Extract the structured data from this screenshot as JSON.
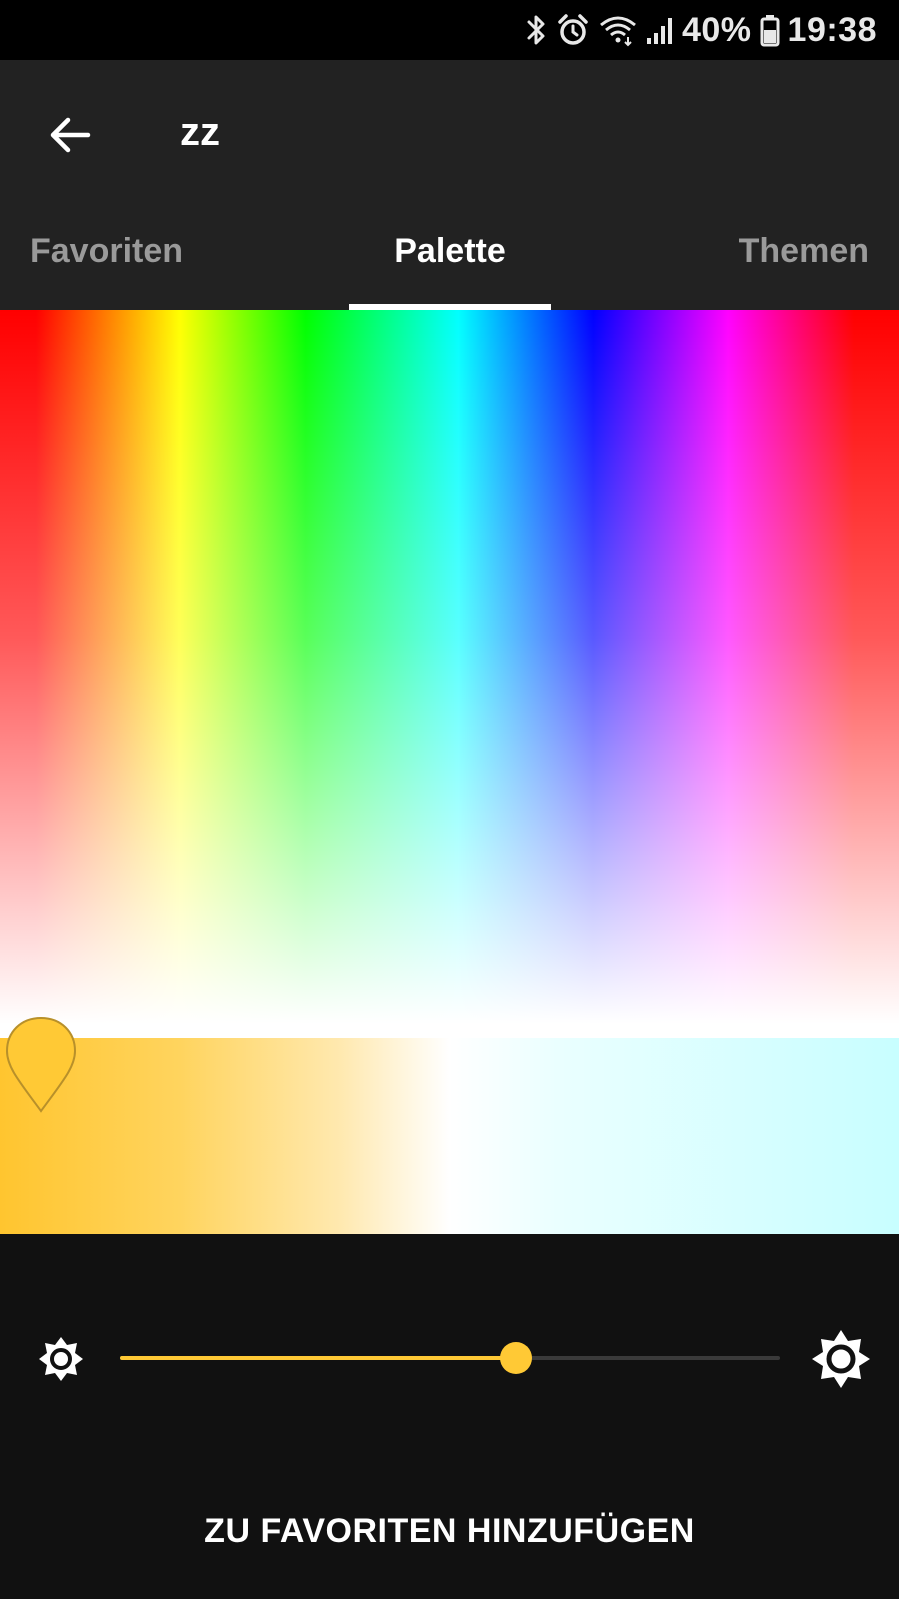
{
  "status_bar": {
    "battery_percent": "40%",
    "time": "19:38",
    "icons": [
      "bluetooth-icon",
      "alarm-icon",
      "wifi-icon",
      "signal-icon",
      "battery-icon"
    ]
  },
  "header": {
    "title": "zz",
    "back_icon": "arrow-left-icon"
  },
  "tabs": [
    {
      "label": "Favoriten",
      "active": false
    },
    {
      "label": "Palette",
      "active": true
    },
    {
      "label": "Themen",
      "active": false
    }
  ],
  "color_picker": {
    "marker_icon": "pin-marker-icon",
    "marker_color": "#ffc935"
  },
  "brightness": {
    "value": 0.6,
    "low_icon": "brightness-low-icon",
    "high_icon": "brightness-high-icon",
    "accent": "#ffc935"
  },
  "actions": {
    "add_favorites_label": "ZU FAVORITEN HINZUFÜGEN"
  }
}
